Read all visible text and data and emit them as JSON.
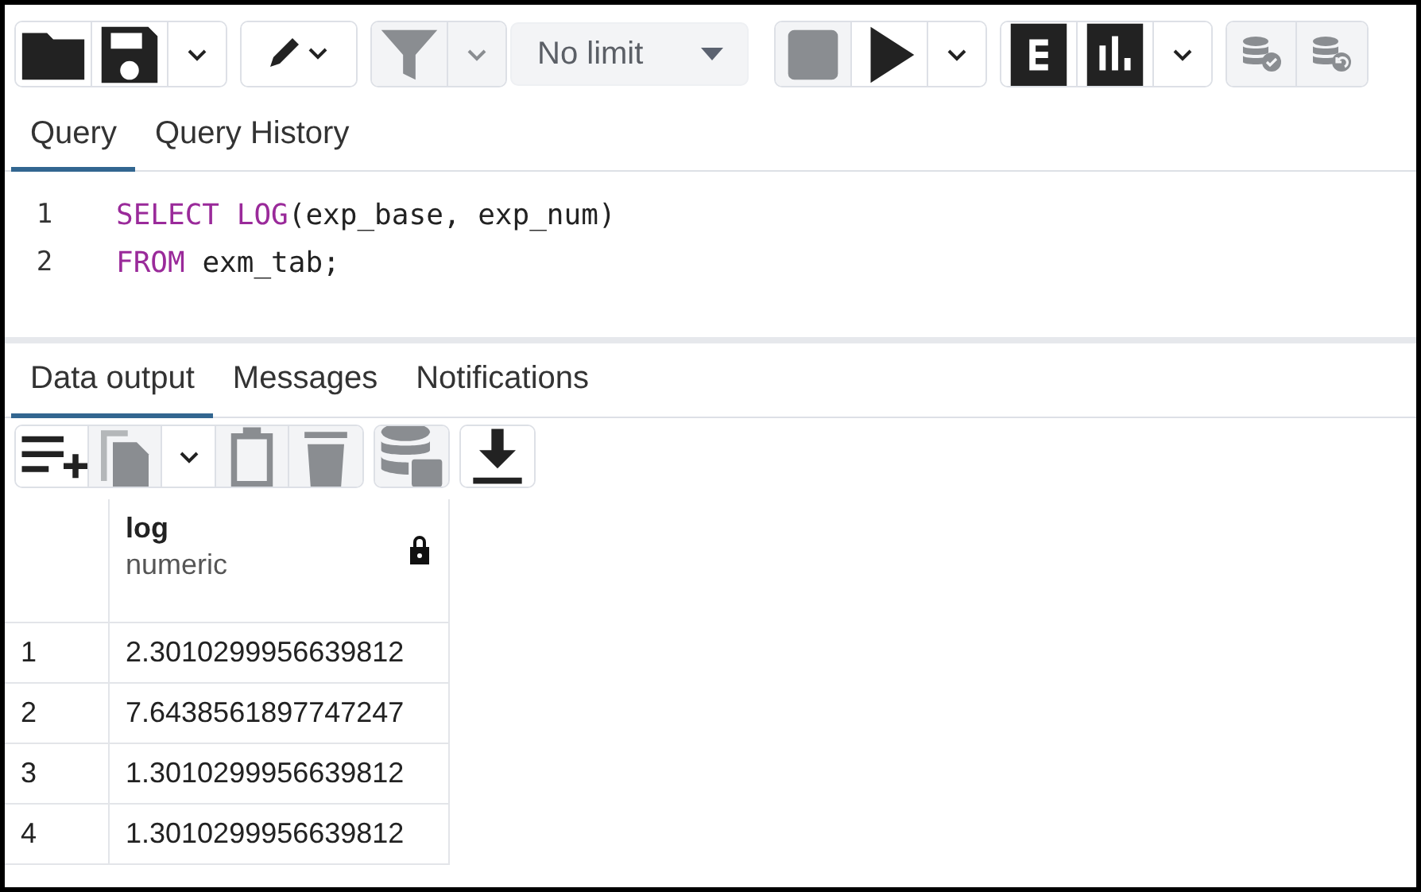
{
  "toolbar": [
    {
      "buttons": [
        {
          "kind": "folder",
          "disabled": false
        },
        {
          "kind": "save",
          "disabled": false
        },
        {
          "kind": "caret",
          "disabled": false
        }
      ]
    },
    {
      "buttons": [
        {
          "kind": "pencil-caret",
          "disabled": false
        }
      ]
    },
    {
      "buttons": [
        {
          "kind": "filter",
          "disabled": true
        },
        {
          "kind": "caret",
          "disabled": true
        }
      ]
    },
    {
      "buttons": [
        {
          "kind": "stop",
          "disabled": true
        },
        {
          "kind": "play",
          "disabled": false
        },
        {
          "kind": "caret",
          "disabled": false
        }
      ]
    },
    {
      "buttons": [
        {
          "kind": "explain",
          "disabled": false
        },
        {
          "kind": "analyze",
          "disabled": false
        },
        {
          "kind": "caret",
          "disabled": false
        }
      ]
    },
    {
      "buttons": [
        {
          "kind": "commit",
          "disabled": true
        },
        {
          "kind": "rollback",
          "disabled": true
        }
      ]
    }
  ],
  "limit": {
    "value": "No limit"
  },
  "query_tabs": [
    {
      "label": "Query",
      "selected": true
    },
    {
      "label": "Query History",
      "selected": false
    }
  ],
  "editor": {
    "lines": [
      {
        "number": "1",
        "tokens": [
          {
            "kind": "keyword",
            "text": "SELECT "
          },
          {
            "kind": "keyword",
            "text": "LOG"
          },
          {
            "kind": "plain",
            "text": "(exp_base, exp_num)"
          }
        ]
      },
      {
        "number": "2",
        "tokens": [
          {
            "kind": "keyword",
            "text": "FROM"
          },
          {
            "kind": "plain",
            "text": " exm_tab;"
          }
        ]
      }
    ]
  },
  "output_tabs": [
    {
      "label": "Data output",
      "selected": true
    },
    {
      "label": "Messages",
      "selected": false
    },
    {
      "label": "Notifications",
      "selected": false
    }
  ],
  "output_toolbar": [
    {
      "buttons": [
        {
          "kind": "add-row",
          "disabled": false
        },
        {
          "kind": "copy",
          "disabled": true
        },
        {
          "kind": "caret",
          "disabled": false
        },
        {
          "kind": "paste",
          "disabled": true
        },
        {
          "kind": "delete",
          "disabled": true
        }
      ]
    },
    {
      "buttons": [
        {
          "kind": "save-data",
          "disabled": true
        }
      ]
    },
    {
      "buttons": [
        {
          "kind": "download",
          "disabled": false
        }
      ]
    }
  ],
  "table": {
    "columns": [
      {
        "name": "log",
        "type": "numeric",
        "locked": true
      }
    ],
    "rows": [
      {
        "number": "1",
        "cells": [
          "2.3010299956639812"
        ]
      },
      {
        "number": "2",
        "cells": [
          "7.6438561897747247"
        ]
      },
      {
        "number": "3",
        "cells": [
          "1.3010299956639812"
        ]
      },
      {
        "number": "4",
        "cells": [
          "1.3010299956639812"
        ]
      }
    ]
  }
}
